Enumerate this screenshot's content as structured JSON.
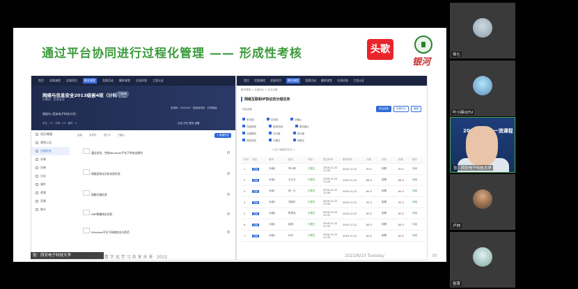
{
  "slide": {
    "title": "通过平台协同进行过程化管理 —— 形成性考核",
    "logo_toutiao": "头歌",
    "logo_yinhe": "银河",
    "footer_date": "2022/8/23 Tuesday",
    "footer_page": "30",
    "footer_left": "数 字 化 学 习 共 享 未 来 · 2022",
    "caption": "张：西安电子科技大学"
  },
  "left_panel": {
    "nav": [
      "首页",
      "实践课程",
      "实践项目",
      "教学课堂",
      "竞赛活动",
      "翻转课堂",
      "交流问答",
      "工程认证"
    ],
    "nav_active_index": 3,
    "course_title": "网络与信息安全2013级嵌4班（计科专业）",
    "course_sub": "计算机 · 信息安全",
    "tag": "已结束",
    "teacher": "高振东  (西安电子科技大学)",
    "stats": "学生 : 74 · 共享 : 23 · 课时 : 4",
    "right_info": "邀请码：XXXXXX · 班级邀请码 · 分享链接",
    "actions": "公告  讨论  签到  设置",
    "sidebar": [
      "首页/概要",
      "课堂公告",
      "分组作业",
      "试卷",
      "问卷",
      "讨论",
      "课件",
      "视频",
      "资源",
      "统计"
    ],
    "sidebar_active_index": 2,
    "toolbar": [
      "全部",
      "未发布",
      "进行中",
      "已截止"
    ],
    "new_button": "+ 新建作业",
    "tasks": [
      "通过实验，完成Windows平台下的攻击操作",
      "网络层协议分析实验任务",
      "网络扫描实验",
      "ARP欺骗攻击实验",
      "Windows平台下网络攻击与防范"
    ]
  },
  "right_panel": {
    "nav": [
      "首页",
      "实践课程",
      "实践项目",
      "教学课堂",
      "竞赛活动",
      "翻转课堂",
      "交流问答",
      "工程认证"
    ],
    "nav_active_index": 3,
    "breadcrumbs": "教学课堂 > 分组作业 > 作业详情",
    "title": "网络互联和IP协议的分组任务",
    "buttons": [
      "导出成绩",
      "查看作业",
      "编辑"
    ],
    "filter_label": "作业状态",
    "check_rows": [
      [
        "未评阅",
        "已评阅",
        "已截止"
      ],
      [
        "作品检查",
        "检查评阅",
        "提交截止"
      ],
      [
        "分组情况",
        "已分组",
        "未分组"
      ],
      [
        "成员状态",
        "已提交",
        "未提交"
      ]
    ],
    "pager": "< 共17组提交作业 >",
    "headers": [
      "序号",
      "作品",
      "组号",
      "组长",
      "状态",
      "提交时间",
      "更新时间",
      "分数",
      "评阅",
      "成绩",
      "操作"
    ],
    "rows": [
      [
        "1",
        "查看",
        "分组6",
        "李小明",
        "已提交",
        "2016-12-22 11:26",
        "2016-12-22",
        "90.0",
        "查看",
        "90.0",
        "评阅"
      ],
      [
        "2",
        "查看",
        "分组2",
        "王大力",
        "已提交",
        "2016-12-22 11:26",
        "2016-12-22",
        "88.0",
        "查看",
        "88.0",
        "评阅"
      ],
      [
        "3",
        "查看",
        "分组7",
        "张一凡",
        "已提交",
        "2016-12-22 11:28",
        "2016-12-22",
        "85.0",
        "查看",
        "85.0",
        "评阅"
      ],
      [
        "4",
        "查看",
        "分组9",
        "刘晓东",
        "已提交",
        "2016-12-22 11:30",
        "2016-12-22",
        "92.0",
        "查看",
        "92.0",
        "评阅"
      ],
      [
        "5",
        "查看",
        "分组8",
        "陈思远",
        "已提交",
        "2016-12-22 11:31",
        "2016-12-22",
        "80.0",
        "查看",
        "80.0",
        "评阅"
      ],
      [
        "6",
        "查看",
        "分组3",
        "赵明",
        "已提交",
        "2016-12-22 11:33",
        "2016-12-22",
        "86.0",
        "查看",
        "86.0",
        "评阅"
      ],
      [
        "7",
        "查看",
        "分组1",
        "孙宇",
        "已提交",
        "2016-12-22 11:35",
        "2016-12-22",
        "89.0",
        "查看",
        "89.0",
        "评阅"
      ]
    ]
  },
  "participants": [
    {
      "name": "恒七"
    },
    {
      "name": "叶小麻XJTU"
    },
    {
      "name": "张 · 西安电子科技大学",
      "speaker_title": "2022年中 ·· 一流课程"
    },
    {
      "name": "卢帅"
    },
    {
      "name": "张霄"
    }
  ]
}
